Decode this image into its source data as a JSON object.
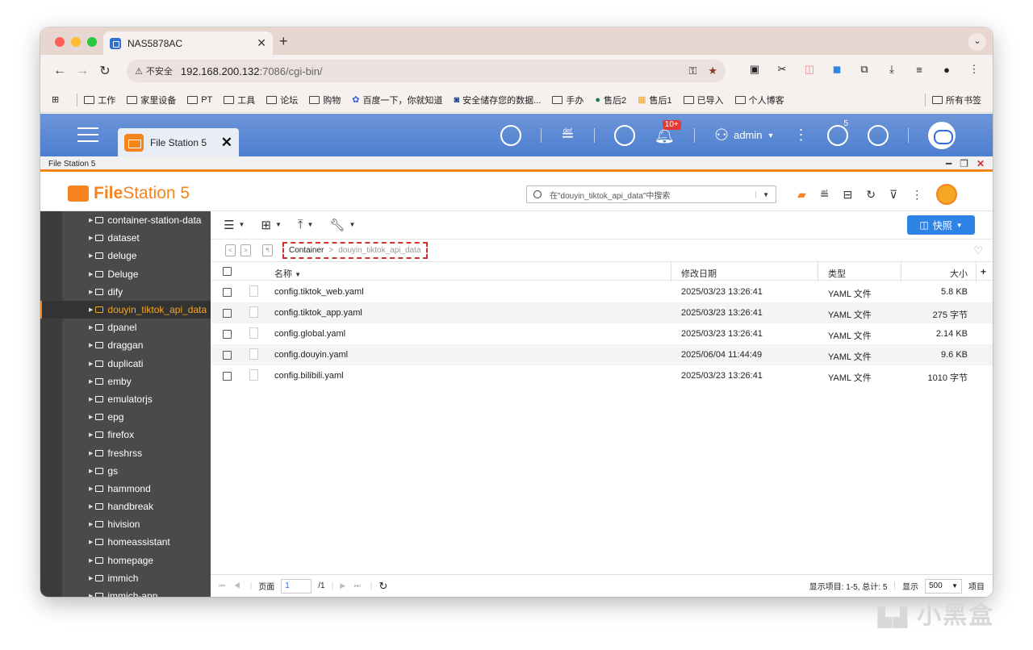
{
  "browser": {
    "tab_title": "NAS5878AC",
    "insecure_label": "不安全",
    "url_host": "192.168.200.132",
    "url_rest": ":7086/cgi-bin/"
  },
  "bookmarks": [
    "工作",
    "家里设备",
    "PT",
    "工具",
    "论坛",
    "购物",
    "百度一下，你就知道",
    "安全储存您的数据...",
    "手办",
    "售后2",
    "售后1",
    "已导入",
    "个人博客"
  ],
  "bookmarks_all": "所有书签",
  "qts": {
    "app_tab": "File Station 5",
    "notification_badge": "10+",
    "user": "admin",
    "info_badge": "5"
  },
  "app": {
    "window_title": "File Station 5",
    "logo_bold": "File",
    "logo_rest": "Station 5",
    "search_placeholder": "在\"douyin_tiktok_api_data\"中搜索",
    "snapshot_label": "快照"
  },
  "sidebar": [
    "container-station-data",
    "dataset",
    "deluge",
    "Deluge",
    "dify",
    "douyin_tiktok_api_data",
    "dpanel",
    "draggan",
    "duplicati",
    "emby",
    "emulatorjs",
    "epg",
    "firefox",
    "freshrss",
    "gs",
    "hammond",
    "handbreak",
    "hivision",
    "homeassistant",
    "homepage",
    "immich",
    "immich-app"
  ],
  "breadcrumb": {
    "root": "Container",
    "sep": ">",
    "current": "douyin_tiktok_api_data"
  },
  "columns": {
    "name": "名称",
    "date": "修改日期",
    "type": "类型",
    "size": "大小"
  },
  "files": [
    {
      "name": "config.tiktok_web.yaml",
      "date": "2025/03/23 13:26:41",
      "type": "YAML 文件",
      "size": "5.8 KB"
    },
    {
      "name": "config.tiktok_app.yaml",
      "date": "2025/03/23 13:26:41",
      "type": "YAML 文件",
      "size": "275 字节"
    },
    {
      "name": "config.global.yaml",
      "date": "2025/03/23 13:26:41",
      "type": "YAML 文件",
      "size": "2.14 KB"
    },
    {
      "name": "config.douyin.yaml",
      "date": "2025/06/04 11:44:49",
      "type": "YAML 文件",
      "size": "9.6 KB"
    },
    {
      "name": "config.bilibili.yaml",
      "date": "2025/03/23 13:26:41",
      "type": "YAML 文件",
      "size": "1010 字节"
    }
  ],
  "footer": {
    "page_label": "页面",
    "page_value": "1",
    "page_total": "/1",
    "display_items": "显示项目: 1-5, 总计: 5",
    "show_label": "显示",
    "per_page": "500",
    "items_label": "项目"
  },
  "watermark": "小黑盒"
}
